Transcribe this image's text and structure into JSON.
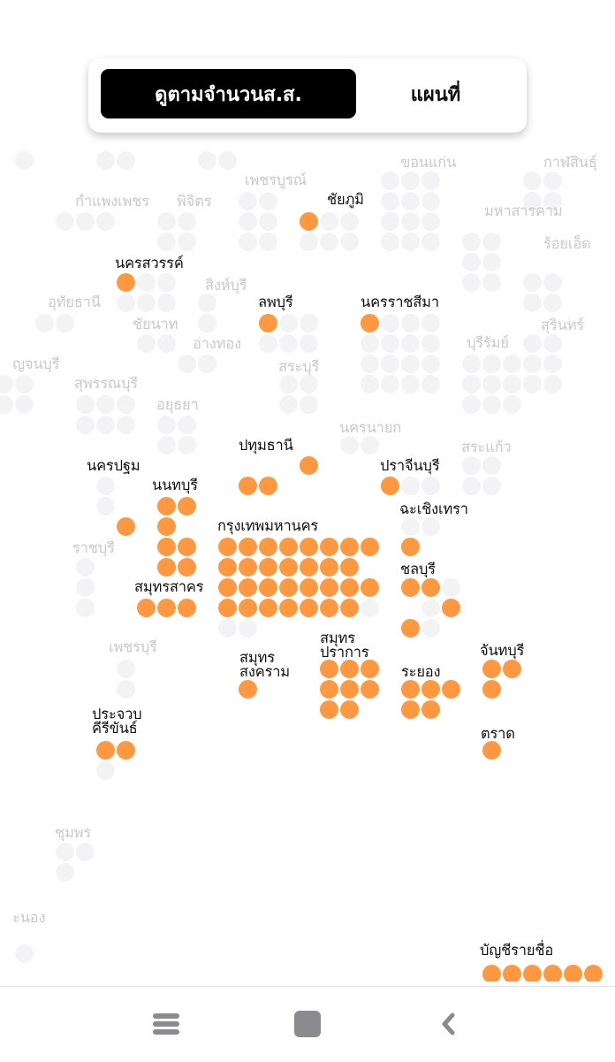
{
  "toggle": {
    "active_label": "ดูตามจำนวนส.ส.",
    "inactive_label": "แผนที่"
  },
  "colors": {
    "highlight": "#ff9840",
    "inactive_dot": "#f3f3f5",
    "active_label": "#111111",
    "inactive_label": "#c9c9cd"
  },
  "provinces": [
    {
      "name": "เพชรบูรณ์",
      "active": false,
      "seats": 0
    },
    {
      "name": "ชัยภูมิ",
      "active": true,
      "seats": 1
    },
    {
      "name": "ขอนแก่น",
      "active": false,
      "seats": 0
    },
    {
      "name": "กาฬสินธุ์",
      "active": false,
      "seats": 0
    },
    {
      "name": "กำแพงเพชร",
      "active": false,
      "seats": 0
    },
    {
      "name": "พิจิตร",
      "active": false,
      "seats": 0
    },
    {
      "name": "มหาสารคาม",
      "active": false,
      "seats": 0
    },
    {
      "name": "ร้อยเอ็ด",
      "active": false,
      "seats": 0
    },
    {
      "name": "นครสวรรค์",
      "active": true,
      "seats": 1
    },
    {
      "name": "สิงห์บุรี",
      "active": false,
      "seats": 0
    },
    {
      "name": "อุทัยธานี",
      "active": false,
      "seats": 0
    },
    {
      "name": "ลพบุรี",
      "active": true,
      "seats": 1
    },
    {
      "name": "นครราชสีมา",
      "active": true,
      "seats": 1
    },
    {
      "name": "ชัยนาท",
      "active": false,
      "seats": 0
    },
    {
      "name": "สุรินทร์",
      "active": false,
      "seats": 0
    },
    {
      "name": "อ่างทอง",
      "active": false,
      "seats": 0
    },
    {
      "name": "บุรีรัมย์",
      "active": false,
      "seats": 0
    },
    {
      "name": "ญจนบุรี",
      "active": false,
      "seats": 0
    },
    {
      "name": "สระบุรี",
      "active": false,
      "seats": 0
    },
    {
      "name": "สุพรรณบุรี",
      "active": false,
      "seats": 0
    },
    {
      "name": "อยุธยา",
      "active": false,
      "seats": 0
    },
    {
      "name": "นครนายก",
      "active": false,
      "seats": 0
    },
    {
      "name": "ปทุมธานี",
      "active": true,
      "seats": 3
    },
    {
      "name": "สระแก้ว",
      "active": false,
      "seats": 0
    },
    {
      "name": "นครปฐม",
      "active": true,
      "seats": 1
    },
    {
      "name": "นนทบุรี",
      "active": true,
      "seats": 7
    },
    {
      "name": "ปราจีนบุรี",
      "active": true,
      "seats": 1
    },
    {
      "name": "ฉะเชิงเทรา",
      "active": true,
      "seats": 1
    },
    {
      "name": "กรุงเทพมหานคร",
      "active": true,
      "seats": 30
    },
    {
      "name": "ราชบุรี",
      "active": false,
      "seats": 0
    },
    {
      "name": "ชลบุรี",
      "active": true,
      "seats": 4
    },
    {
      "name": "สมุทรสาคร",
      "active": true,
      "seats": 3
    },
    {
      "name": "เพชรบุรี",
      "active": false,
      "seats": 0
    },
    {
      "name": "สมุทร\nปราการ",
      "active": true,
      "seats": 8
    },
    {
      "name": "จันทบุรี",
      "active": true,
      "seats": 3
    },
    {
      "name": "สมุทร\nสงคราม",
      "active": true,
      "seats": 1
    },
    {
      "name": "ระยอง",
      "active": true,
      "seats": 5
    },
    {
      "name": "ประจวบ\nคีรีขันธ์",
      "active": true,
      "seats": 2
    },
    {
      "name": "ตราด",
      "active": true,
      "seats": 1
    },
    {
      "name": "ชุมพร",
      "active": false,
      "seats": 0
    },
    {
      "name": "ะนอง",
      "active": false,
      "seats": 0
    },
    {
      "name": "บัญชีรายชื่อ",
      "active": true,
      "seats": 6
    }
  ],
  "nav": {
    "recents_icon": "recents-icon",
    "home_icon": "home-icon",
    "back_icon": "back-icon"
  }
}
